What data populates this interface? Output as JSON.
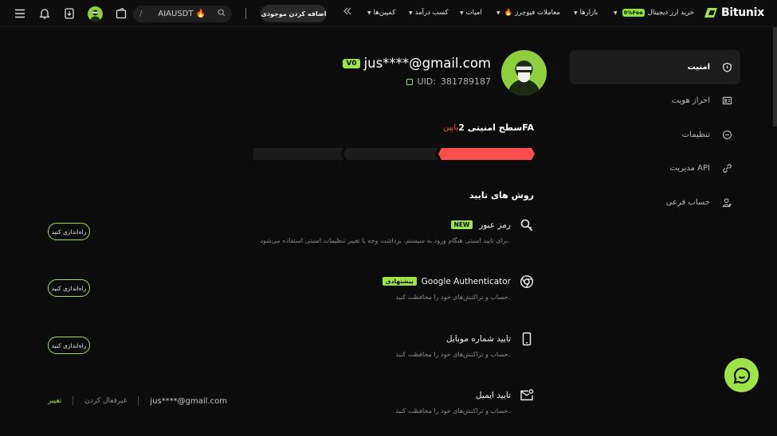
{
  "colors": {
    "accent": "#9fe34a",
    "danger": "#ff4d4d",
    "background": "#0c0c0c",
    "panel": "#1d1d1d"
  },
  "topbar": {
    "search_slash": "/",
    "search_text": "AIAUSDT",
    "add_funds": "اضافه کردن موجودی",
    "nav": [
      {
        "label": "خرید ارز دیجیتال",
        "badge": "0%Fee"
      },
      {
        "label": "بازارها"
      },
      {
        "label": "معاملات فیوچرز"
      },
      {
        "label": "امیات"
      },
      {
        "label": "کسب درآمد"
      },
      {
        "label": "کمپین‌ها"
      }
    ],
    "logo": "Bitunix",
    "icons": [
      "menu-icon",
      "bell-icon",
      "download-icon",
      "avatar",
      "wallet-icon",
      "search-icon"
    ]
  },
  "sidebar": {
    "items": [
      {
        "label": "امنیت",
        "icon": "shield-icon",
        "active": true
      },
      {
        "label": "احراز هویت",
        "icon": "id-card-icon",
        "active": false
      },
      {
        "label": "تنظیمات",
        "icon": "settings-icon",
        "active": false
      },
      {
        "label": "مدیریت API",
        "icon": "api-icon",
        "active": false
      },
      {
        "label": "حساب فرعی",
        "icon": "sub-account-icon",
        "active": false
      }
    ]
  },
  "profile": {
    "email": "jus****@gmail.com",
    "vip": "V0",
    "uid_label": "UID:",
    "uid": "381789187"
  },
  "security": {
    "title": "سطح امنیتی 2FA",
    "level": "پایین",
    "meter_level": 1,
    "meter_segments": 3
  },
  "verification": {
    "title": "روش های تایید",
    "methods": [
      {
        "name": "رمز عبور",
        "tag": "NEW",
        "desc": "برای تایید امنیتی هنگام ورود به سیستم، برداشت وجه یا تغییر تنظیمات امنیتی استفاده می‌شود.",
        "action": "راه‌اندازی کنید",
        "icon": "key-icon"
      },
      {
        "name": "Google Authenticator",
        "tag": "پیشنهادی",
        "desc": "حساب و تراکنش‌های خود را محافظت کنید.",
        "action": "راه‌اندازی کنید",
        "icon": "google-auth-icon"
      },
      {
        "name": "تایید شماره موبایل",
        "tag": "",
        "desc": "حساب و تراکنش‌های خود را محافظت کنید.",
        "action": "راه‌اندازی کنید",
        "icon": "phone-icon"
      },
      {
        "name": "تایید ایمیل",
        "tag": "",
        "desc": "حساب و تراکنش‌های خود را محافظت کنید.",
        "email": "jus****@gmail.com",
        "disable": "غیرفعال کردن",
        "change": "تغییر",
        "icon": "email-icon"
      }
    ]
  }
}
